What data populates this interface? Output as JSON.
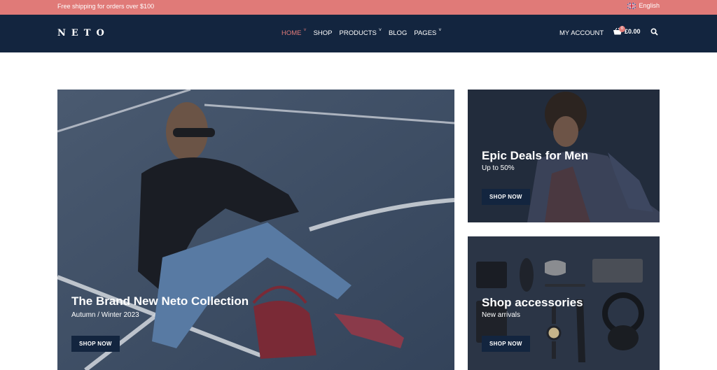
{
  "topbar": {
    "promo": "Free shipping for orders over $100",
    "language": "English",
    "language_icon": "uk-flag-icon"
  },
  "nav": {
    "logo": "NETO",
    "items": [
      {
        "label": "HOME",
        "active": true,
        "dropdown": true
      },
      {
        "label": "SHOP",
        "active": false,
        "dropdown": false
      },
      {
        "label": "PRODUCTS",
        "active": false,
        "dropdown": true
      },
      {
        "label": "BLOG",
        "active": false,
        "dropdown": false
      },
      {
        "label": "PAGES",
        "active": false,
        "dropdown": true
      }
    ],
    "account": "MY ACCOUNT",
    "cart_total": "£0.00",
    "cart_count": "0",
    "cart_icon": "basket-icon",
    "search_icon": "search-icon"
  },
  "banners": {
    "hero": {
      "title": "The Brand New Neto Collection",
      "subtitle": "Autumn / Winter 2023",
      "button": "SHOP NOW"
    },
    "men": {
      "title": "Epic Deals for Men",
      "subtitle": "Up to 50%",
      "button": "SHOP NOW"
    },
    "accessories": {
      "title": "Shop accessories",
      "subtitle": "New arrivals",
      "button": "SHOP NOW"
    }
  },
  "colors": {
    "accent": "#e07a78",
    "navy": "#13253f"
  }
}
